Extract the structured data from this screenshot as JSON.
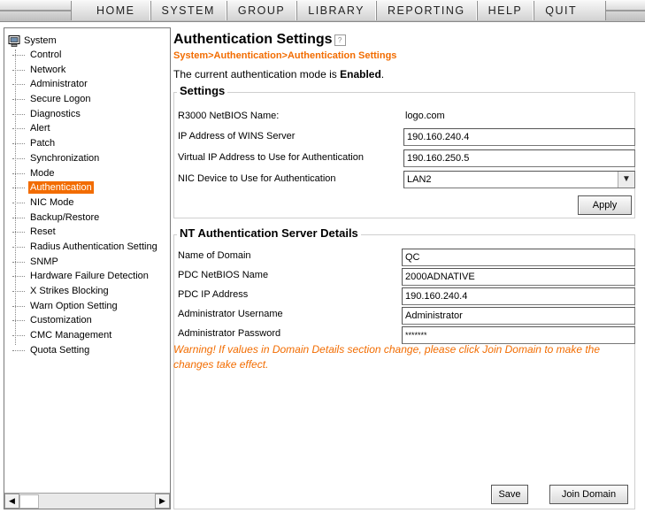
{
  "nav": {
    "items": [
      "HOME",
      "SYSTEM",
      "GROUP",
      "LIBRARY",
      "REPORTING",
      "HELP",
      "QUIT"
    ]
  },
  "sidebar": {
    "root": "System",
    "items": [
      "Control",
      "Network",
      "Administrator",
      "Secure Logon",
      "Diagnostics",
      "Alert",
      "Patch",
      "Synchronization",
      "Mode",
      "Authentication",
      "NIC Mode",
      "Backup/Restore",
      "Reset",
      "Radius Authentication Setting",
      "SNMP",
      "Hardware Failure Detection",
      "X Strikes Blocking",
      "Warn Option Setting",
      "Customization",
      "CMC Management",
      "Quota Setting"
    ],
    "active": "Authentication"
  },
  "main": {
    "title": "Authentication Settings",
    "breadcrumb": "System>Authentication>Authentication Settings",
    "mode_prefix": "The current authentication mode is ",
    "mode_value": "Enabled",
    "mode_suffix": "."
  },
  "settings": {
    "legend": "Settings",
    "netbios_label": "R3000 NetBIOS Name:",
    "netbios_value": "logo.com",
    "wins_label": "IP Address of WINS Server",
    "wins_value": "190.160.240.4",
    "vip_label": "Virtual IP Address to Use for Authentication",
    "vip_value": "190.160.250.5",
    "nic_label": "NIC Device to Use for Authentication",
    "nic_value": "LAN2",
    "apply_label": "Apply"
  },
  "nt": {
    "legend": "NT Authentication Server Details",
    "domain_label": "Name of Domain",
    "domain_value": "QC",
    "pdc_netbios_label": "PDC NetBIOS Name",
    "pdc_netbios_value": "2000ADNATIVE",
    "pdc_ip_label": "PDC IP Address",
    "pdc_ip_value": "190.160.240.4",
    "admin_user_label": "Administrator Username",
    "admin_user_value": "Administrator",
    "admin_pass_label": "Administrator Password",
    "admin_pass_value": "*******",
    "warning": "Warning! If values in Domain Details section change, please click Join Domain to make the changes take effect.",
    "save_label": "Save",
    "join_label": "Join Domain"
  }
}
